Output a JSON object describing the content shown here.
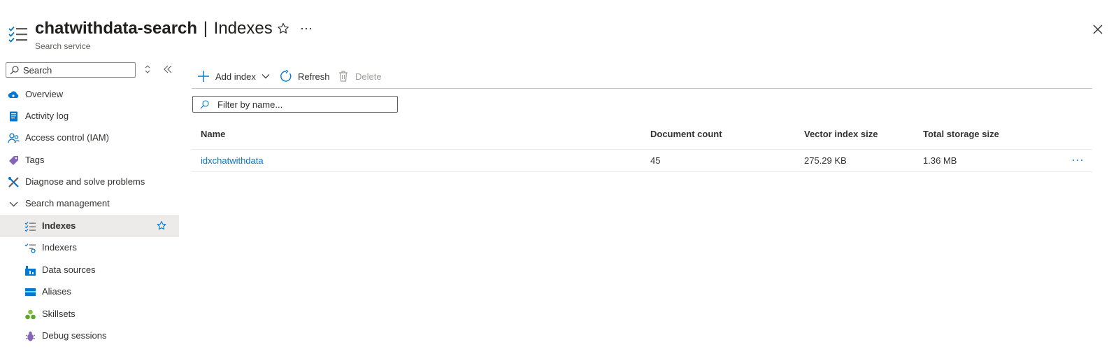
{
  "header": {
    "service_name": "chatwithdata-search",
    "separator": "|",
    "page_title": "Indexes",
    "subtitle": "Search service"
  },
  "sidebar": {
    "search_placeholder": "Search",
    "items": [
      {
        "label": "Overview",
        "icon": "cloud-icon"
      },
      {
        "label": "Activity log",
        "icon": "activity-log-icon"
      },
      {
        "label": "Access control (IAM)",
        "icon": "people-icon"
      },
      {
        "label": "Tags",
        "icon": "tag-icon"
      },
      {
        "label": "Diagnose and solve problems",
        "icon": "wrench-icon"
      },
      {
        "label": "Search management",
        "icon": "chevron-down-icon"
      },
      {
        "label": "Indexes",
        "icon": "index-list-icon",
        "selected": true
      },
      {
        "label": "Indexers",
        "icon": "indexer-icon"
      },
      {
        "label": "Data sources",
        "icon": "data-sources-icon"
      },
      {
        "label": "Aliases",
        "icon": "aliases-icon"
      },
      {
        "label": "Skillsets",
        "icon": "skillsets-icon"
      },
      {
        "label": "Debug sessions",
        "icon": "bug-icon"
      }
    ]
  },
  "toolbar": {
    "add_index": "Add index",
    "refresh": "Refresh",
    "delete": "Delete"
  },
  "filter": {
    "placeholder": "Filter by name..."
  },
  "table": {
    "columns": [
      "Name",
      "Document count",
      "Vector index size",
      "Total storage size"
    ],
    "rows": [
      {
        "name": "idxchatwithdata",
        "document_count": "45",
        "vector_index_size": "275.29 KB",
        "total_storage_size": "1.36 MB"
      }
    ]
  },
  "colors": {
    "accent": "#0078d4",
    "selected_bg": "#edebe9",
    "text": "#323130"
  }
}
